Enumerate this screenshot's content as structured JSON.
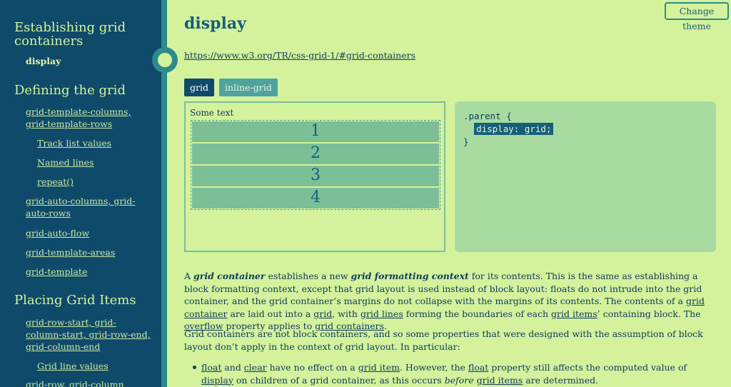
{
  "sidebar": {
    "section1_title": "Establishing grid containers",
    "section1_items": [
      "display"
    ],
    "section2_title": "Defining the grid",
    "section2_items": {
      "a": "grid-template-columns, grid-template-rows",
      "a_sub1": "Track list values",
      "a_sub2": "Named lines",
      "a_sub3": "repeat()",
      "b": "grid-auto-columns, grid-auto-rows",
      "c": "grid-auto-flow",
      "d": "grid-template-areas",
      "e": "grid-template"
    },
    "section3_title": "Placing Grid Items",
    "section3_items": {
      "a": "grid-row-start, grid-column-start, grid-row-end, grid-column-end",
      "a_sub1": "Grid line values",
      "b": "grid-row, grid-column"
    }
  },
  "header": {
    "change_theme": "Change theme",
    "title": "display",
    "spec_link": "https://www.w3.org/TR/css-grid-1/#grid-containers"
  },
  "tabs": [
    "grid",
    "inline-grid"
  ],
  "demo": {
    "text": "Some text",
    "items": [
      "1",
      "2",
      "3",
      "4"
    ]
  },
  "code": {
    "line1": ".parent {",
    "line2": "display: grid;",
    "line3": "}"
  },
  "content": {
    "p1": {
      "t1": "A ",
      "em1": "grid container",
      "t2": " establishes a new ",
      "em2": "grid formatting context",
      "t3": " for its contents. This is the same as establishing a block formatting context, except that grid layout is used instead of block layout: floats do not intrude into the grid container, and the grid container’s margins do not collapse with the margins of its contents. The contents of a ",
      "l1": "grid container",
      "t4": " are laid out into a ",
      "l2": "grid",
      "t5": ", with ",
      "l3": "grid lines",
      "t6": " forming the boundaries of each ",
      "l4": "grid items",
      "t7": "’ containing block. The ",
      "l5": "overflow",
      "t8": " property applies to ",
      "l6": "grid containers",
      "t9": "."
    },
    "p2": "Grid containers are not block containers, and so some properties that were designed with the assumption of block layout don’t apply in the context of grid layout. In particular:",
    "bullet1": {
      "l1": "float",
      "t1": " and ",
      "l2": "clear",
      "t2": " have no effect on a ",
      "l3": "grid item",
      "t3": ". However, the ",
      "l4": "float",
      "t4": " property still affects the computed value of ",
      "l5": "display",
      "t5": " on children of a grid container, as this occurs ",
      "em": "before",
      "t6": " ",
      "l6": "grid items",
      "t7": " are determined."
    }
  }
}
